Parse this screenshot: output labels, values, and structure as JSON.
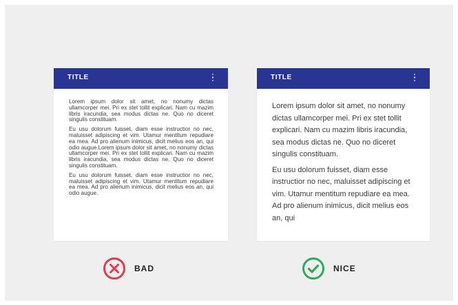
{
  "colors": {
    "header": "#283593",
    "bad": "#e53950",
    "nice": "#2eaa5c"
  },
  "cards": {
    "bad": {
      "title": "TITLE",
      "p1": "Lorem ipsum dolor sit amet, no nonumy dictas ullamcorper mei. Pri ex stet tollit explicari. Nam cu mazim libris iracundia, sea modus dictas ne. Quo no diceret singulis constituam.",
      "p2": "Eu usu dolorum fuisset, diam esse instructior no nec, maluisset adipiscing et vim. Utamur mentitum repudiare ea mea. Ad pro alienum inimicus, dicit melius eos an, qui odio augue.Lorem ipsum dolor sit amet, no nonumy dictas ullamcorper mei. Pri ex stet tollit explicari. Nam cu mazim libris iracundia, sea modus dictas ne. Quo no diceret singulis constituam.",
      "p3": "Eu usu dolorum fuisset, diam esse instructior no nec, maluisset adipiscing et vim. Utamur mentitum repudiare ea mea. Ad pro alienum inimicus, dicit melius eos an, qui odio augue."
    },
    "nice": {
      "title": "TITLE",
      "p1": "Lorem ipsum dolor sit amet, no nonumy dictas ullamcorper mei. Pri ex stet tollit explicari. Nam cu mazim libris iracundia, sea modus dictas ne. Quo no diceret singulis constituam.",
      "p2": "Eu usu dolorum fuisset, diam esse instructior no nec, maluisset adipiscing et vim. Utamur mentitum repudiare ea mea. Ad pro alienum inimicus, dicit melius eos an, qui"
    }
  },
  "verdicts": {
    "bad": {
      "label": "BAD",
      "icon": "x-circle-icon"
    },
    "nice": {
      "label": "NICE",
      "icon": "check-circle-icon"
    }
  }
}
